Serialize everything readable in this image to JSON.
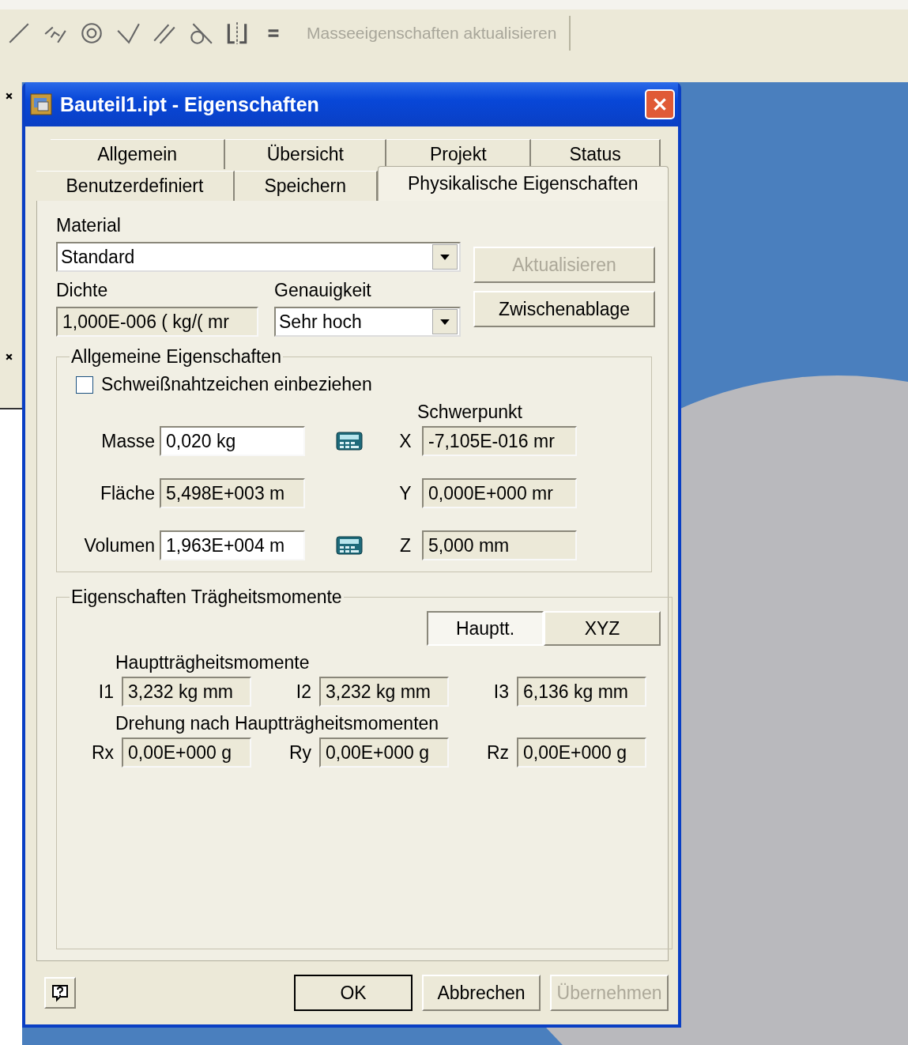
{
  "toolbar": {
    "update_button": {
      "label": "Masseeigenschaften aktualisieren",
      "disabled": true
    }
  },
  "window": {
    "title": "Bauteil1.ipt - Eigenschaften"
  },
  "tab_rows": [
    [
      {
        "label": "Allgemein",
        "selected": false
      },
      {
        "label": "Übersicht",
        "selected": false
      },
      {
        "label": "Projekt",
        "selected": false
      },
      {
        "label": "Status",
        "selected": false
      }
    ],
    [
      {
        "label": "Benutzerdefiniert",
        "selected": false
      },
      {
        "label": "Speichern",
        "selected": false
      },
      {
        "label": "Physikalische Eigenschaften",
        "selected": true
      }
    ]
  ],
  "material": {
    "label": "Material",
    "value": "Standard"
  },
  "side_buttons": [
    {
      "label": "Aktualisieren",
      "disabled": true
    },
    {
      "label": "Zwischenablage",
      "disabled": false
    }
  ],
  "density": {
    "label": "Dichte",
    "value": "1,000E-006 ( kg/( mr"
  },
  "accuracy": {
    "label": "Genauigkeit",
    "value": "Sehr hoch"
  },
  "general": {
    "title": "Allgemeine Eigenschaften",
    "weld_checkbox": {
      "label": "Schweißnahtzeichen einbeziehen",
      "checked": false
    },
    "center_title": "Schwerpunkt",
    "rows": [
      {
        "label": "Masse",
        "value": "0,020 kg",
        "editable": true,
        "calculator": true,
        "axis": "X",
        "center": "-7,105E-016 mr"
      },
      {
        "label": "Fläche",
        "value": "5,498E+003 m",
        "editable": false,
        "calculator": false,
        "axis": "Y",
        "center": "0,000E+000 mr"
      },
      {
        "label": "Volumen",
        "value": "1,963E+004 m",
        "editable": true,
        "calculator": true,
        "axis": "Z",
        "center": "5,000 mm"
      }
    ]
  },
  "inertia": {
    "title": "Eigenschaften Trägheitsmomente",
    "toggle": [
      {
        "label": "Hauptt.",
        "selected": true
      },
      {
        "label": "XYZ",
        "selected": false
      }
    ],
    "moments_title": "Hauptträgheitsmomente",
    "moments": [
      {
        "label": "I1",
        "value": "3,232 kg mm"
      },
      {
        "label": "I2",
        "value": "3,232 kg mm"
      },
      {
        "label": "I3",
        "value": "6,136 kg mm"
      }
    ],
    "rotation_title": "Drehung nach Hauptträgheitsmomenten",
    "rotations": [
      {
        "label": "Rx",
        "value": "0,00E+000 g"
      },
      {
        "label": "Ry",
        "value": "0,00E+000 g"
      },
      {
        "label": "Rz",
        "value": "0,00E+000 g"
      }
    ]
  },
  "buttons": [
    {
      "label": "OK",
      "default": true,
      "disabled": false
    },
    {
      "label": "Abbrechen",
      "default": false,
      "disabled": false
    },
    {
      "label": "Übernehmen",
      "default": false,
      "disabled": true
    }
  ]
}
